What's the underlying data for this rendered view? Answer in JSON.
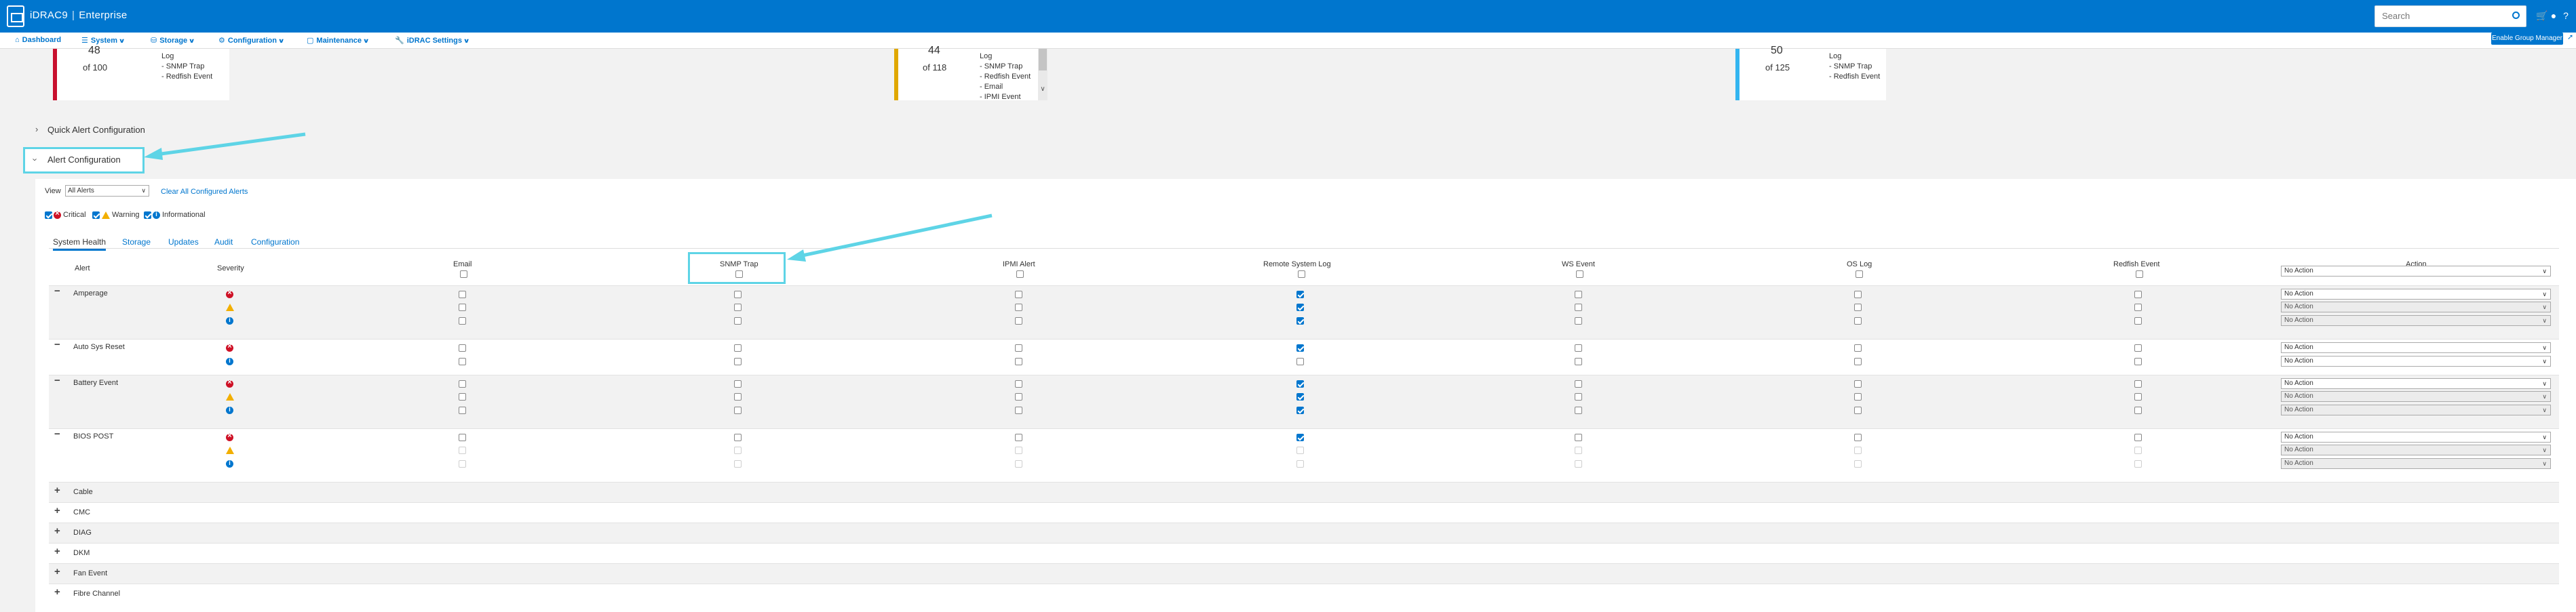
{
  "topbar": {
    "brand": "iDRAC9",
    "edition": "Enterprise",
    "search_placeholder": "Search"
  },
  "nav": {
    "items": [
      "Dashboard",
      "System",
      "Storage",
      "Configuration",
      "Maintenance",
      "iDRAC Settings"
    ],
    "enable_group_manager": "Enable Group Manager"
  },
  "summary_cards": [
    {
      "number": "48",
      "of": "of 100",
      "lines": [
        "Log",
        "- SNMP Trap",
        "- Redfish Event"
      ],
      "color": "#c8102e"
    },
    {
      "number": "44",
      "of": "of 118",
      "lines": [
        "Log",
        "- SNMP Trap",
        "- Redfish Event",
        "- Email",
        "- IPMI Event"
      ],
      "color": "#e0a800"
    },
    {
      "number": "50",
      "of": "of 125",
      "lines": [
        "Log",
        "- SNMP Trap",
        "- Redfish Event"
      ],
      "color": "#33b5f0"
    }
  ],
  "quick_alert": {
    "label": "Quick Alert Configuration"
  },
  "alert_config": {
    "label": "Alert Configuration",
    "view_label": "View",
    "view_value": "All Alerts",
    "clear_link": "Clear All Configured Alerts",
    "filters": {
      "critical": "Critical",
      "warning": "Warning",
      "informational": "Informational"
    }
  },
  "tabs": [
    "System Health",
    "Storage",
    "Updates",
    "Audit",
    "Configuration"
  ],
  "columns": {
    "alert": "Alert",
    "severity": "Severity",
    "email": "Email",
    "snmp": "SNMP Trap",
    "ipmi": "IPMI Alert",
    "rsyslog": "Remote System Log",
    "ws": "WS Event",
    "oslog": "OS Log",
    "redfish": "Redfish Event",
    "action": "Action"
  },
  "action_default": "No Action",
  "alerts": [
    {
      "name": "Amperage",
      "expanded": true,
      "severities": [
        "critical",
        "warning",
        "info"
      ],
      "remote_log": [
        true,
        true,
        true
      ]
    },
    {
      "name": "Auto Sys Reset",
      "expanded": true,
      "severities": [
        "critical",
        "info"
      ],
      "remote_log": [
        true,
        false
      ]
    },
    {
      "name": "Battery Event",
      "expanded": true,
      "severities": [
        "critical",
        "warning",
        "info"
      ],
      "remote_log": [
        true,
        true,
        true
      ]
    },
    {
      "name": "BIOS POST",
      "expanded": true,
      "severities": [
        "critical",
        "warning",
        "info"
      ],
      "remote_log": [
        true,
        false,
        false
      ]
    },
    {
      "name": "Cable",
      "expanded": false
    },
    {
      "name": "CMC",
      "expanded": false
    },
    {
      "name": "DIAG",
      "expanded": false
    },
    {
      "name": "DKM",
      "expanded": false
    },
    {
      "name": "Fan Event",
      "expanded": false
    },
    {
      "name": "Fibre Channel",
      "expanded": false
    }
  ],
  "colors": {
    "brand_blue": "#0076ce",
    "highlight_cyan": "#5ed4e6",
    "critical": "#ce1126",
    "warning": "#f2af00"
  }
}
